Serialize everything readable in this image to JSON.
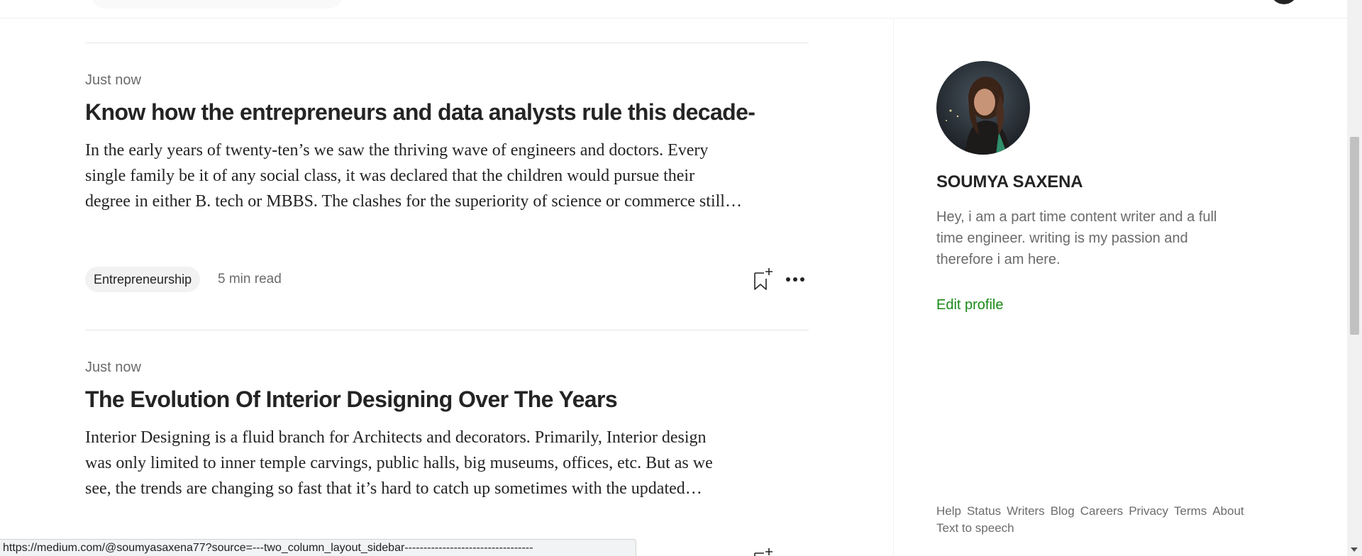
{
  "articles": [
    {
      "date": "Just now",
      "title": "Know how the entrepreneurs and data analysts rule this decade-",
      "excerpt_lines": [
        "In the early years of twenty-ten’s we saw the thriving wave of engineers and doctors. Every",
        "single family be it of any social class, it was declared that the children would pursue their",
        "degree in either B. tech or MBBS. The clashes for the superiority of science or commerce still…"
      ],
      "tag": "Entrepreneurship",
      "read_time": "5 min read"
    },
    {
      "date": "Just now",
      "title": "The Evolution Of Interior Designing Over The Years",
      "excerpt_lines": [
        "Interior Designing is a fluid branch for Architects and decorators. Primarily, Interior design",
        "was only limited to inner temple carvings, public halls, big museums, offices, etc. But as we",
        "see, the trends are changing so fast that it’s hard to catch up sometimes with the updated…"
      ]
    }
  ],
  "sidebar": {
    "name": "SOUMYA SAXENA",
    "bio": "Hey, i am a part time content writer and a full time engineer. writing is my passion and therefore i am here.",
    "edit_profile": "Edit profile",
    "footer_links": [
      "Help",
      "Status",
      "Writers",
      "Blog",
      "Careers",
      "Privacy",
      "Terms",
      "About",
      "Text to speech"
    ]
  },
  "status_bar": {
    "url": "https://medium.com/@soumyasaxena77?source=---two_column_layout_sidebar----------------------------------"
  },
  "colors": {
    "accent_green": "#1a8917",
    "text_primary": "#242424",
    "text_secondary": "#6b6b6b"
  },
  "icons": [
    "bookmark-add-icon",
    "more-options-icon"
  ]
}
